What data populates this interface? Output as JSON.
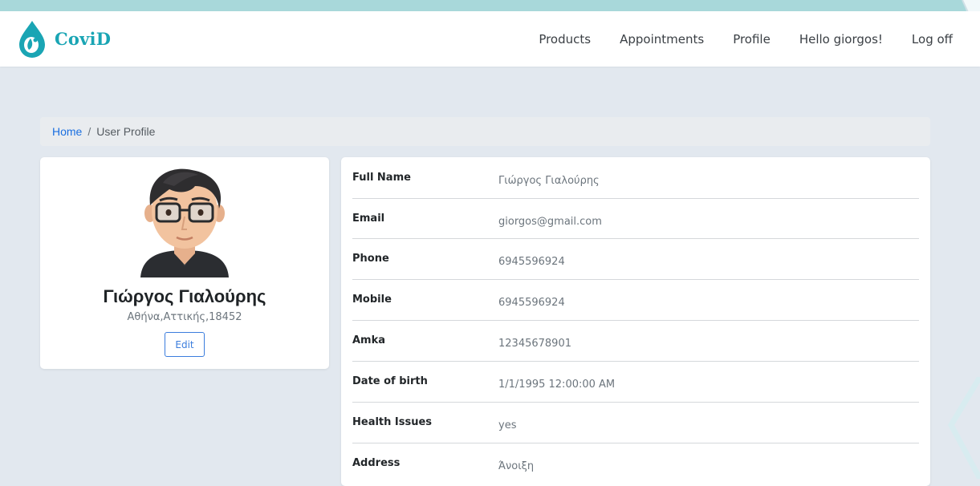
{
  "colors": {
    "accent": "#1aa5b4",
    "link": "#1a6fe0",
    "page_background": "#e2e8ef",
    "top_strip": "#a8d8da"
  },
  "navbar": {
    "brand": "CoviD",
    "brand_icon": "droplet-logo-icon",
    "links": [
      "Products",
      "Appointments",
      "Profile",
      "Hello giorgos!",
      "Log off"
    ]
  },
  "breadcrumb": {
    "home": "Home",
    "separator": "/",
    "current": "User Profile"
  },
  "profile": {
    "name": "Γιώργος Γιαλούρης",
    "location": "Αθήνα,Αττικής,18452",
    "edit_label": "Edit",
    "avatar_icon": "avatar-icon"
  },
  "details": [
    {
      "label": "Full Name",
      "value": "Γιώργος Γιαλούρης"
    },
    {
      "label": "Email",
      "value": "giorgos@gmail.com"
    },
    {
      "label": "Phone",
      "value": "6945596924"
    },
    {
      "label": "Mobile",
      "value": "6945596924"
    },
    {
      "label": "Amka",
      "value": "12345678901"
    },
    {
      "label": "Date of birth",
      "value": "1/1/1995 12:00:00 AM"
    },
    {
      "label": "Health Issues",
      "value": "yes"
    },
    {
      "label": "Address",
      "value": "Άνοιξη"
    }
  ]
}
